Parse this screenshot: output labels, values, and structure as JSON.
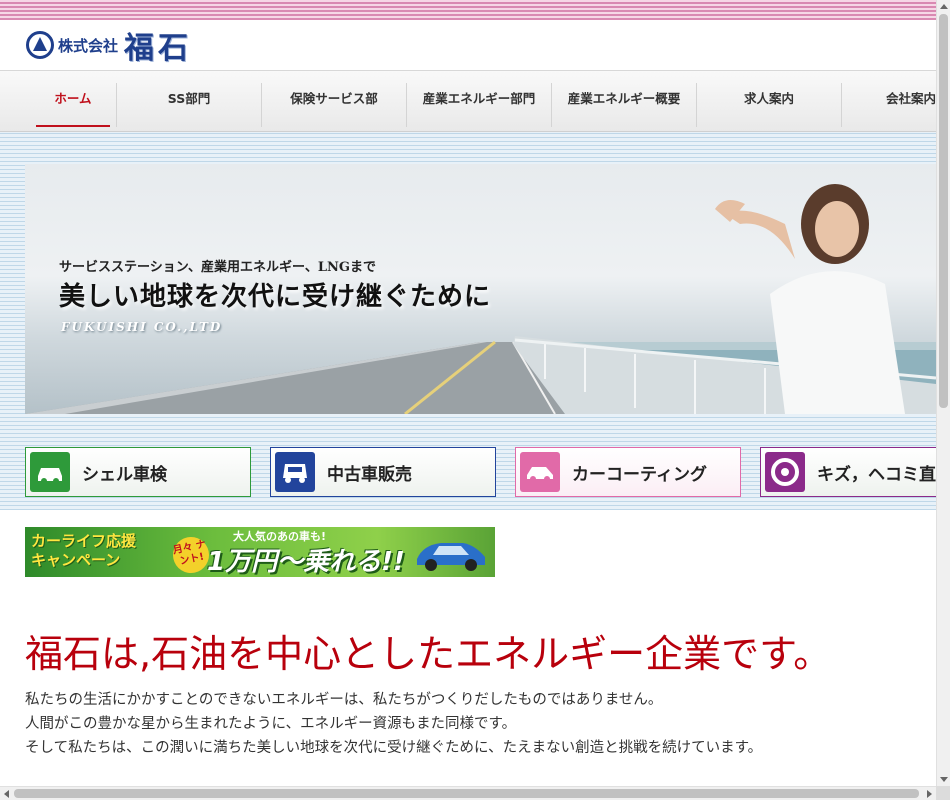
{
  "header": {
    "logo_small": "株式会社",
    "logo_big": "福石"
  },
  "nav": {
    "items": [
      {
        "label": "ホーム",
        "active": true
      },
      {
        "label": "SS部門"
      },
      {
        "label": "保険サービス部"
      },
      {
        "label": "産業エネルギー部門"
      },
      {
        "label": "産業エネルギー概要"
      },
      {
        "label": "求人案内"
      },
      {
        "label": "会社案内"
      }
    ]
  },
  "hero": {
    "subtitle": "サービスステーション、産業用エネルギー、LNGまで",
    "title": "美しい地球を次代に受け継ぐために",
    "company_en": "FUKUISHI CO.,LTD"
  },
  "services": [
    {
      "label": "シェル車検",
      "icon": "car-inspection-icon",
      "color": "#2e9a3a"
    },
    {
      "label": "中古車販売",
      "icon": "used-car-icon",
      "color": "#22449c"
    },
    {
      "label": "カーコーティング",
      "icon": "car-coating-icon",
      "color": "#e16aa8"
    },
    {
      "label": "キズ，ヘコミ直",
      "icon": "tire-repair-icon",
      "color": "#8b2a8a"
    }
  ],
  "campaign": {
    "left_line1": "カーライフ応援",
    "left_line2": "キャンペーン",
    "badge": "月々 ナント!",
    "top": "大人気のあの車も!",
    "main": "1万円～乗れる!!"
  },
  "main": {
    "headline": "福石は,石油を中心としたエネルギー企業です。",
    "paragraph": [
      "私たちの生活にかかすことのできないエネルギーは、私たちがつくりだしたものではありません。",
      "人間がこの豊かな星から生まれたように、エネルギー資源もまた同様です。",
      "そして私たちは、この潤いに満ちた美しい地球を次代に受け継ぐために、たえまない創造と挑戦を続けています。"
    ]
  },
  "colors": {
    "accent_red": "#b8000c",
    "brand_blue": "#1f3f8c"
  }
}
